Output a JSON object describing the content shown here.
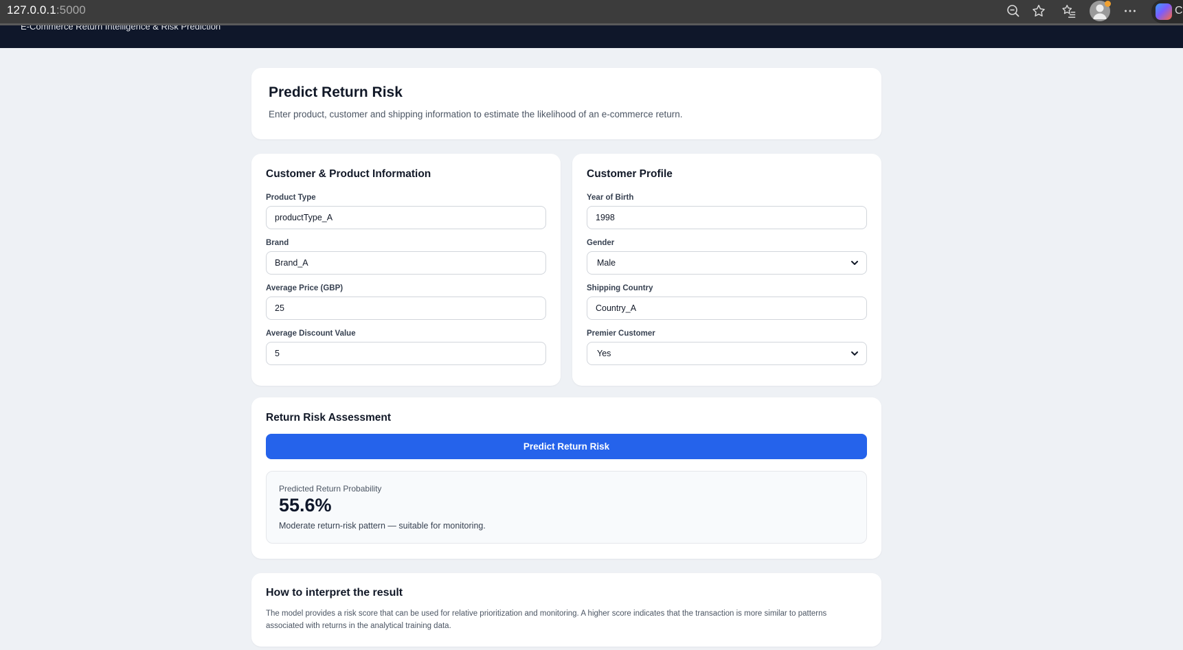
{
  "browser": {
    "url_host": "127.0.0.1",
    "url_port": ":5000",
    "icons": [
      "zoom-out-icon",
      "star-icon",
      "favorites-icon",
      "profile-icon",
      "more-icon",
      "copilot-icon"
    ],
    "edge_letter": "C"
  },
  "app": {
    "header_title": "E-Commerce Return Intelligence & Risk Prediction"
  },
  "hero": {
    "title": "Predict Return Risk",
    "subtitle": "Enter product, customer and shipping information to estimate the likelihood of an e-commerce return."
  },
  "product_panel": {
    "title": "Customer & Product Information",
    "fields": [
      {
        "label": "Product Type",
        "value": "productType_A"
      },
      {
        "label": "Brand",
        "value": "Brand_A"
      },
      {
        "label": "Average Price (GBP)",
        "value": "25"
      },
      {
        "label": "Average Discount Value",
        "value": "5"
      }
    ]
  },
  "profile_panel": {
    "title": "Customer Profile",
    "fields": [
      {
        "label": "Year of Birth",
        "value": "1998"
      },
      {
        "label": "Gender",
        "value": "Male"
      },
      {
        "label": "Shipping Country",
        "value": "Country_A"
      },
      {
        "label": "Premier Customer",
        "value": "Yes"
      }
    ]
  },
  "assessment": {
    "title": "Return Risk Assessment",
    "button_label": "Predict Return Risk",
    "result_label": "Predicted Return Probability",
    "result_value": "55.6%",
    "result_note": "Moderate return-risk pattern — suitable for monitoring."
  },
  "interpret": {
    "title": "How to interpret the result",
    "body": "The model provides a risk score that can be used for relative prioritization and monitoring. A higher score indicates that the transaction is more similar to patterns associated with returns in the analytical training data."
  },
  "colors": {
    "primary": "#2563eb",
    "header_bg": "#0f172a",
    "page_bg": "#eef1f5"
  }
}
